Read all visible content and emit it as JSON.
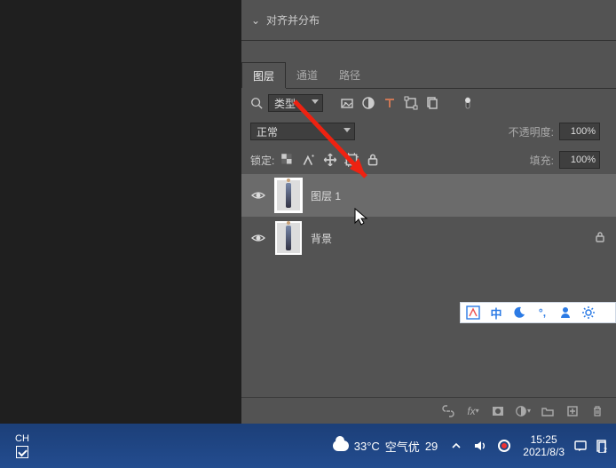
{
  "align_panel": {
    "title": "对齐并分布"
  },
  "panel_tabs": [
    {
      "label": "图层",
      "active": true
    },
    {
      "label": "通道",
      "active": false
    },
    {
      "label": "路径",
      "active": false
    }
  ],
  "filter_row": {
    "kind_label": "类型"
  },
  "blend_row": {
    "mode_label": "正常",
    "opacity_label": "不透明度:",
    "opacity_value": "100%"
  },
  "lock_row": {
    "lock_label": "锁定:",
    "fill_label": "填充:",
    "fill_value": "100%"
  },
  "layers": [
    {
      "name": "图层 1",
      "visible": true,
      "selected": true,
      "locked": false
    },
    {
      "name": "背景",
      "visible": true,
      "selected": false,
      "locked": true
    }
  ],
  "ime_bar": {
    "mode": "中"
  },
  "taskbar": {
    "lang": "CH",
    "temp": "33°C",
    "air_label": "空气优",
    "air_value": "29",
    "time": "15:25",
    "date": "2021/8/3"
  }
}
